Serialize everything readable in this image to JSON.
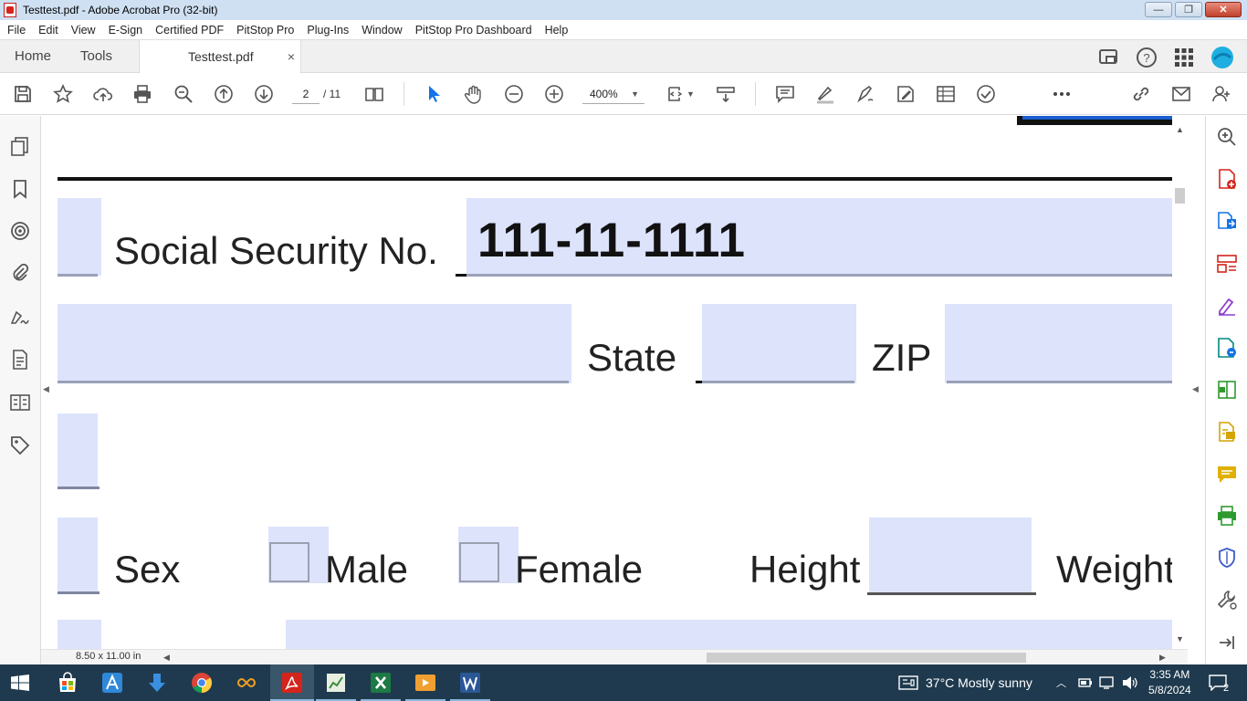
{
  "window": {
    "title": "Testtest.pdf - Adobe Acrobat Pro (32-bit)"
  },
  "menu": [
    "File",
    "Edit",
    "View",
    "E-Sign",
    "Certified PDF",
    "PitStop Pro",
    "Plug-Ins",
    "Window",
    "PitStop Pro Dashboard",
    "Help"
  ],
  "tabs": {
    "home": "Home",
    "tools": "Tools",
    "document": "Testtest.pdf",
    "close": "×"
  },
  "toolbar": {
    "page_current": "2",
    "page_total": "/ 11",
    "zoom": "400%"
  },
  "document": {
    "ssn_label": "Social Security No.",
    "ssn_value": "111-11-1111",
    "state_label": "State",
    "zip_label": "ZIP",
    "sex_label": "Sex",
    "male_label": "Male",
    "female_label": "Female",
    "height_label": "Height",
    "weight_label": "Weight"
  },
  "status": {
    "page_size": "8.50 x 11.00 in"
  },
  "taskbar": {
    "weather": "37°C  Mostly sunny",
    "time": "3:35 AM",
    "date": "5/8/2024",
    "notifications": "2"
  },
  "colors": {
    "form_field": "#dde3fb",
    "accent": "#1473e6",
    "taskbar": "#1f3a4e"
  }
}
